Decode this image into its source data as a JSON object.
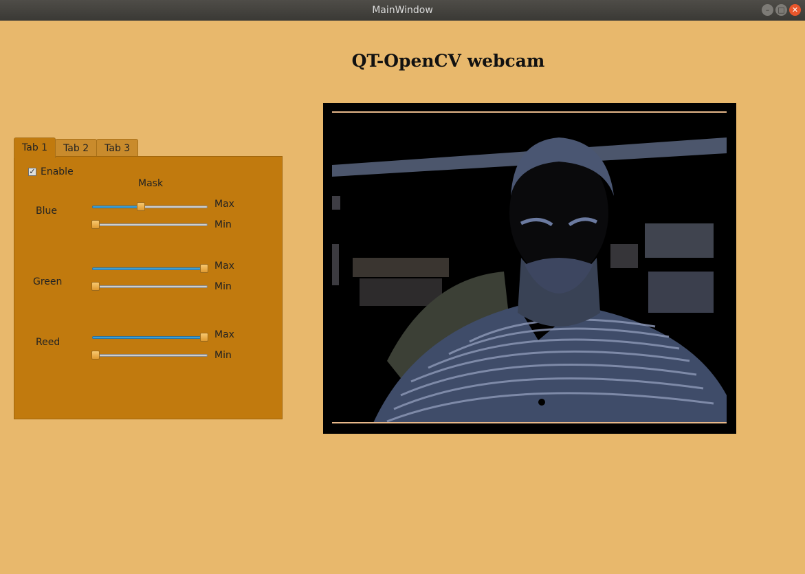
{
  "window": {
    "title": "MainWindow",
    "controls": [
      "minimize",
      "maximize",
      "close"
    ]
  },
  "heading": "QT-OpenCV webcam",
  "tabs": [
    {
      "label": "Tab 1",
      "active": true
    },
    {
      "label": "Tab 2",
      "active": false
    },
    {
      "label": "Tab 3",
      "active": false
    }
  ],
  "panel": {
    "enable": {
      "label": "Enable",
      "checked": true
    },
    "mask_label": "Mask",
    "channels": [
      {
        "label": "Blue",
        "max": {
          "label": "Max",
          "value_fraction": 0.42
        },
        "min": {
          "label": "Min",
          "value_fraction": 0.0
        }
      },
      {
        "label": "Green",
        "max": {
          "label": "Max",
          "value_fraction": 1.0
        },
        "min": {
          "label": "Min",
          "value_fraction": 0.0
        }
      },
      {
        "label": "Reed",
        "max": {
          "label": "Max",
          "value_fraction": 1.0
        },
        "min": {
          "label": "Min",
          "value_fraction": 0.0
        }
      }
    ]
  },
  "video": {
    "description_icon": "webcam-frame"
  },
  "colors": {
    "background": "#e8b86c",
    "panel": "#c17a0e",
    "slider_fill": "#3d9fd6",
    "close_button": "#e9562b"
  }
}
